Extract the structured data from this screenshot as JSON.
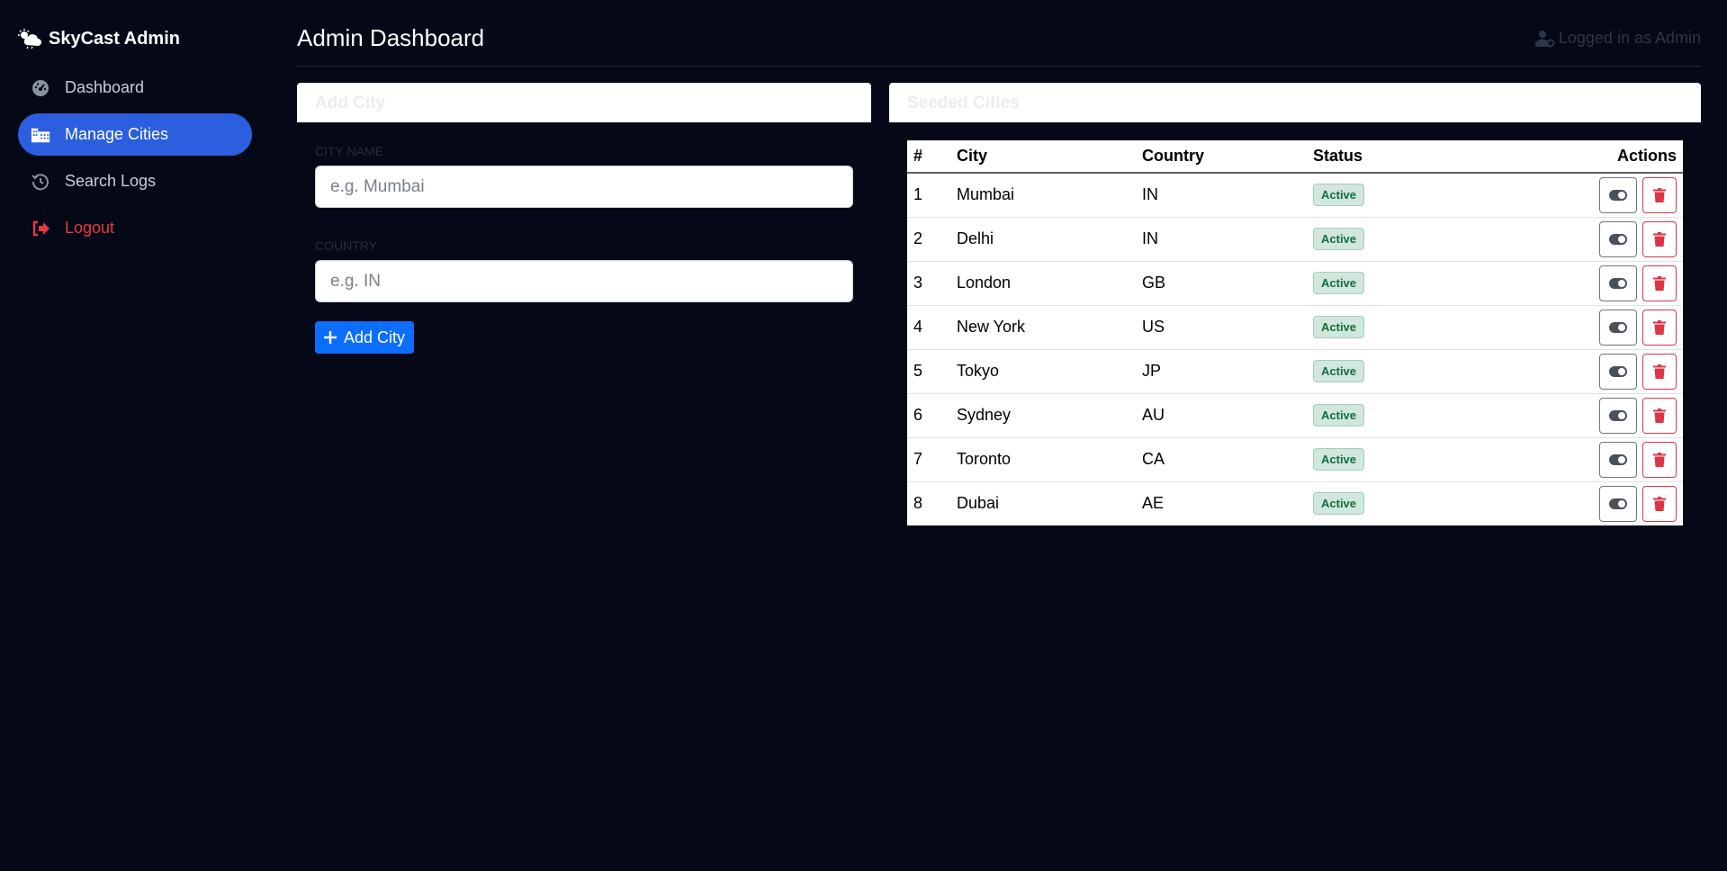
{
  "brand": {
    "name": "SkyCast Admin"
  },
  "sidebar": {
    "items": [
      {
        "label": "Dashboard",
        "icon": "gauge-icon"
      },
      {
        "label": "Manage Cities",
        "icon": "city-icon",
        "active": true
      },
      {
        "label": "Search Logs",
        "icon": "history-icon"
      },
      {
        "label": "Logout",
        "icon": "logout-icon"
      }
    ]
  },
  "header": {
    "title": "Admin Dashboard",
    "user_text": "Logged in as Admin"
  },
  "add_city": {
    "title": "Add City",
    "city_label": "CITY NAME",
    "city_placeholder": "e.g. Mumbai",
    "country_label": "COUNTRY",
    "country_placeholder": "e.g. IN",
    "button_label": "Add City"
  },
  "seeded": {
    "title": "Seeded Cities",
    "columns": [
      "#",
      "City",
      "Country",
      "Status",
      "Actions"
    ],
    "rows": [
      {
        "num": "1",
        "city": "Mumbai",
        "country": "IN",
        "status": "Active"
      },
      {
        "num": "2",
        "city": "Delhi",
        "country": "IN",
        "status": "Active"
      },
      {
        "num": "3",
        "city": "London",
        "country": "GB",
        "status": "Active"
      },
      {
        "num": "4",
        "city": "New York",
        "country": "US",
        "status": "Active"
      },
      {
        "num": "5",
        "city": "Tokyo",
        "country": "JP",
        "status": "Active"
      },
      {
        "num": "6",
        "city": "Sydney",
        "country": "AU",
        "status": "Active"
      },
      {
        "num": "7",
        "city": "Toronto",
        "country": "CA",
        "status": "Active"
      },
      {
        "num": "8",
        "city": "Dubai",
        "country": "AE",
        "status": "Active"
      }
    ]
  },
  "colors": {
    "background": "#050816",
    "accent": "#2b5fe0",
    "primary_button": "#0d6efd",
    "danger": "#dc3545",
    "success_badge": "#d1e7dd"
  }
}
